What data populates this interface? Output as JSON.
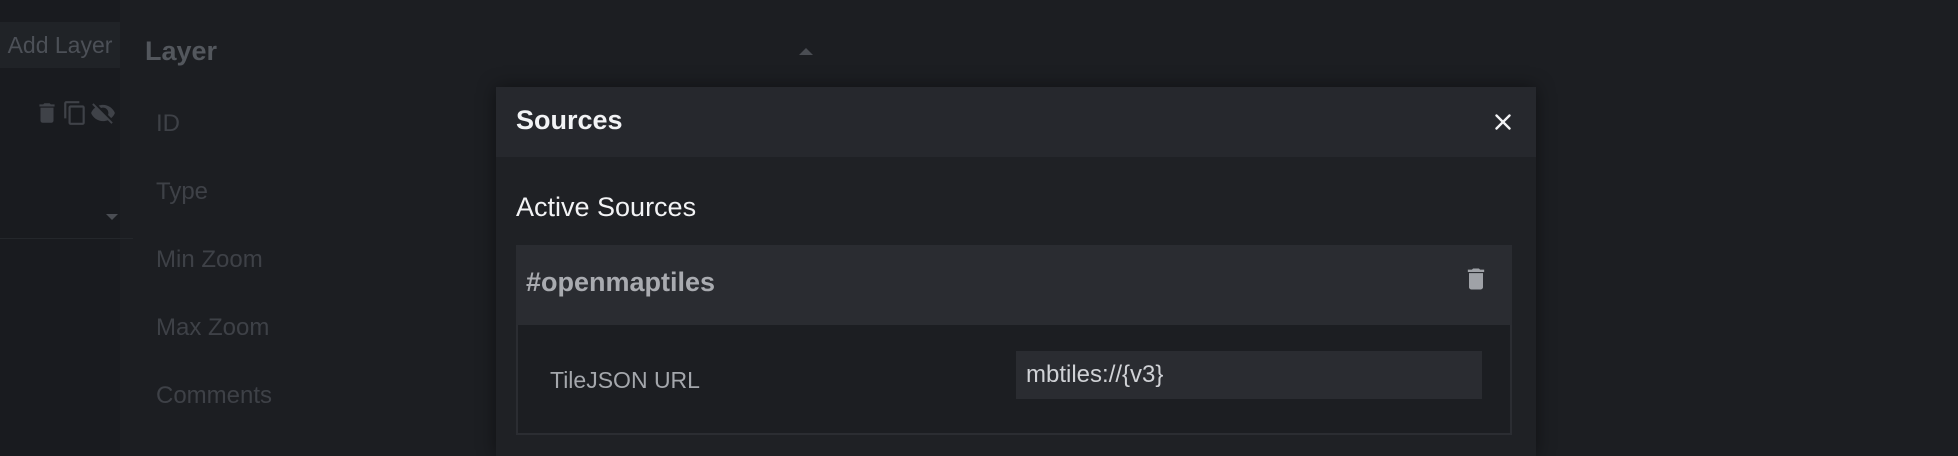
{
  "background": {
    "add_layer_label": "Add Layer",
    "layer_panel": {
      "title": "Layer",
      "properties": [
        "ID",
        "Type",
        "Min Zoom",
        "Max Zoom",
        "Comments"
      ]
    },
    "layer_action_icons": [
      "trash-icon",
      "copy-icon",
      "eye-off-icon"
    ]
  },
  "modal": {
    "title": "Sources",
    "close_icon": "close-icon",
    "active_sources_title": "Active Sources",
    "sources": [
      {
        "name": "#openmaptiles",
        "delete_icon": "trash-icon",
        "fields": [
          {
            "label": "TileJSON URL",
            "value": "mbtiles://{v3}"
          }
        ]
      }
    ]
  },
  "colors": {
    "page_bg": "#1c1e22",
    "modal_header_bg": "#26282d",
    "card_header_bg": "#2a2c31",
    "text_primary": "#f2f3f5",
    "text_muted": "#a4a7ac"
  }
}
